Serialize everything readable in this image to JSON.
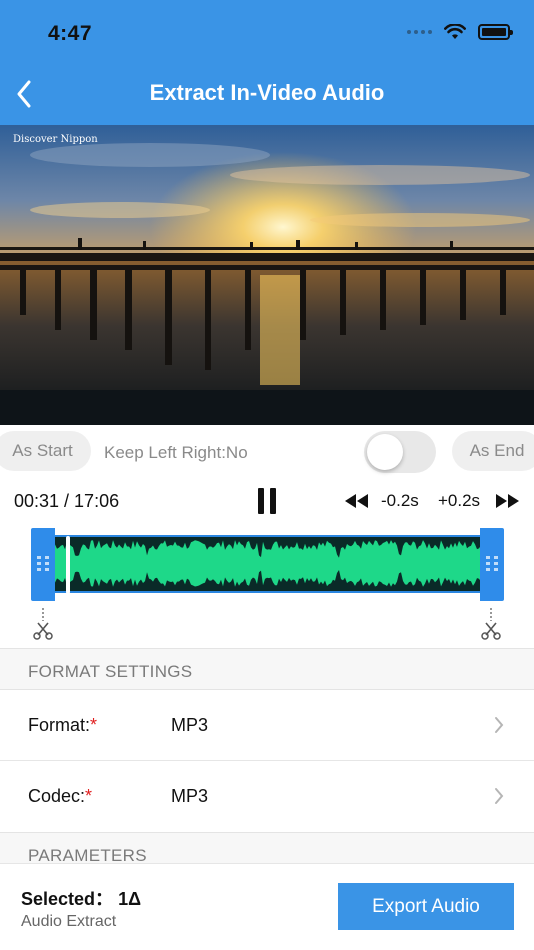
{
  "status_bar": {
    "time": "4:47"
  },
  "header": {
    "title": "Extract In-Video Audio",
    "back_icon": "chevron-left-icon"
  },
  "video": {
    "watermark": "Discover Nippon"
  },
  "controls": {
    "as_start": "As Start",
    "keep_label": "Keep Left Right:No",
    "toggle_on": false,
    "as_end": "As End"
  },
  "playback": {
    "time": "00:31 / 17:06",
    "step_back": "-0.2s",
    "step_forward": "+0.2s"
  },
  "colors": {
    "accent": "#3a94e6",
    "waveform": "#1ed889",
    "waveform_bg": "#0a2a28",
    "required": "#e02020"
  },
  "format_section": {
    "header": "FORMAT SETTINGS",
    "format_label": "Format:",
    "format_value": "MP3",
    "codec_label": "Codec:",
    "codec_value": "MP3",
    "required_mark": "*"
  },
  "parameters_section": {
    "header": "PARAMETERS"
  },
  "bottom_bar": {
    "selected_label": "Selected：",
    "selected_value": "1Δ",
    "subtitle": "Audio Extract",
    "export_label": "Export Audio"
  }
}
